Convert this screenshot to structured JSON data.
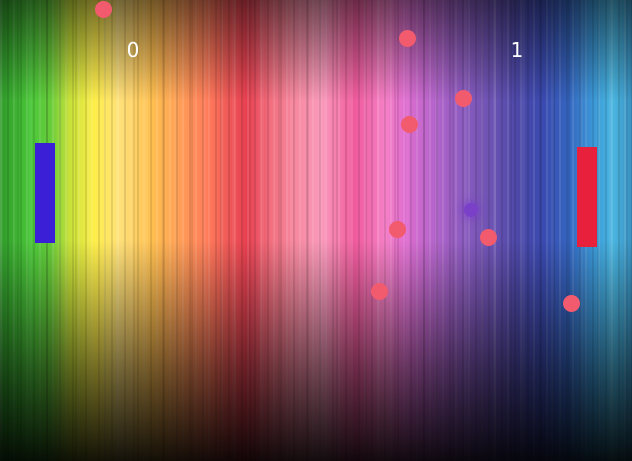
{
  "score": {
    "left": "0",
    "right": "1"
  },
  "colors": {
    "left_paddle": "#3a1fd6",
    "right_paddle": "#e8203c",
    "particle": "#f25a6e",
    "main_ball": "#7a40c8",
    "score_text": "#ffffff"
  },
  "particles_count": 9
}
